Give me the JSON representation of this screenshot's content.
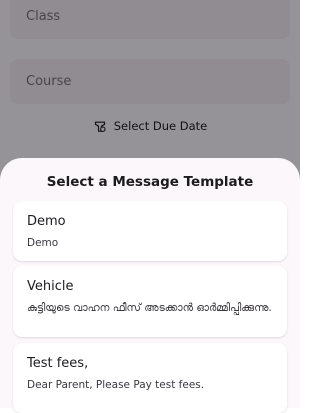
{
  "form": {
    "class_placeholder": "Class",
    "course_placeholder": "Course",
    "due_date_label": "Select Due Date",
    "due_date_icon": "calendar-icon"
  },
  "sheet": {
    "title": "Select a Message Template",
    "templates": [
      {
        "title": "Demo",
        "body": "Demo"
      },
      {
        "title": "Vehicle",
        "body": "കുട്ടിയുടെ വാഹന ഫീസ് അടക്കാൻ ഓർമ്മിപ്പിക്കുന്നു."
      },
      {
        "title": "Test fees,",
        "body": "Dear Parent, Please Pay test fees."
      }
    ]
  },
  "colors": {
    "field_bg": "#e9e2ec",
    "sheet_bg": "#fbf7fb",
    "scrim": "rgba(0,0,0,0.38)"
  }
}
